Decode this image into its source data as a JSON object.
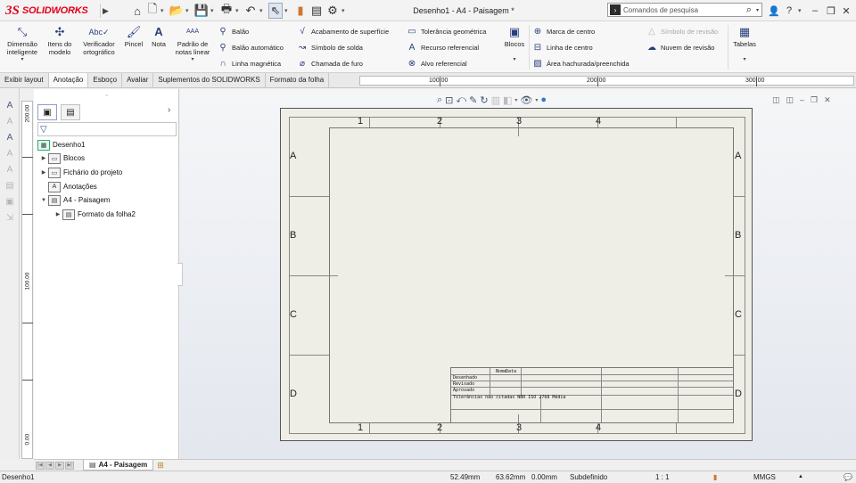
{
  "titlebar": {
    "brand_ds": "3S",
    "brand_name": "SOLIDWORKS",
    "document_title": "Desenho1 - A4 - Paisagem *",
    "search_placeholder": "Comandos de pesquisa",
    "quick_access_icons": [
      "home-icon",
      "new-document-icon",
      "open-icon",
      "save-icon",
      "print-icon",
      "undo-icon",
      "select-icon",
      "rebuild-icon",
      "file-properties-icon",
      "options-icon"
    ]
  },
  "ribbon": {
    "smart_dimension": "Dimensão inteligente",
    "model_items": "Itens do modelo",
    "spell_checker": "Verificador ortográfico",
    "format_painter": "Pincel",
    "note": "Nota",
    "linear_note_pattern": "Padrão de notas linear",
    "balloon": "Balão",
    "auto_balloon": "Balão automático",
    "magnetic_line": "Linha magnética",
    "surface_finish": "Acabamento de superfície",
    "weld_symbol": "Símbolo de solda",
    "hole_callout": "Chamada de furo",
    "geometric_tolerance": "Tolerância geométrica",
    "datum_feature": "Recurso referencial",
    "datum_target": "Alvo referencial",
    "blocks": "Blocos",
    "center_mark": "Marca de centro",
    "centerline": "Linha de centro",
    "area_hatch": "Área hachurada/preenchida",
    "revision_symbol": "Símbolo de revisão",
    "revision_cloud": "Nuvem de revisão",
    "tables": "Tabelas"
  },
  "tabs": [
    "Exibir layout",
    "Anotação",
    "Esboço",
    "Avaliar",
    "Suplementos do SOLIDWORKS",
    "Formato da folha"
  ],
  "active_tab": "Anotação",
  "rulers": {
    "horizontal": [
      "100.00",
      "200.00",
      "300.00"
    ],
    "vertical": [
      "200.00",
      "100.00",
      "0.00"
    ]
  },
  "feature_tree": {
    "items": [
      {
        "label": "Desenho1",
        "level": 0,
        "expandable": false
      },
      {
        "label": "Blocos",
        "level": 1,
        "expandable": true
      },
      {
        "label": "Fichário do projeto",
        "level": 1,
        "expandable": true
      },
      {
        "label": "Anotações",
        "level": 1,
        "expandable": false
      },
      {
        "label": "A4 - Paisagem",
        "level": 1,
        "expandable": true,
        "expanded": true
      },
      {
        "label": "Formato da folha2",
        "level": 2,
        "expandable": true
      }
    ]
  },
  "sheet": {
    "zone_columns": [
      "1",
      "2",
      "3",
      "4"
    ],
    "zone_rows": [
      "A",
      "B",
      "C",
      "D"
    ],
    "title_block": {
      "col_name": "Nome",
      "col_date": "Data",
      "row1": "Desenhado",
      "row2": "Revisado",
      "row3": "Aprovado",
      "row4": "Tolerâncias não citadas NBR ISO 2768 Média"
    }
  },
  "sheet_tab": "A4 - Paisagem",
  "statusbar": {
    "doc_name": "Desenho1",
    "x": "52.49mm",
    "y": "63.62mm",
    "z": "0.00mm",
    "state": "Subdefinido",
    "scale": "1 : 1",
    "units": "MMGS"
  }
}
